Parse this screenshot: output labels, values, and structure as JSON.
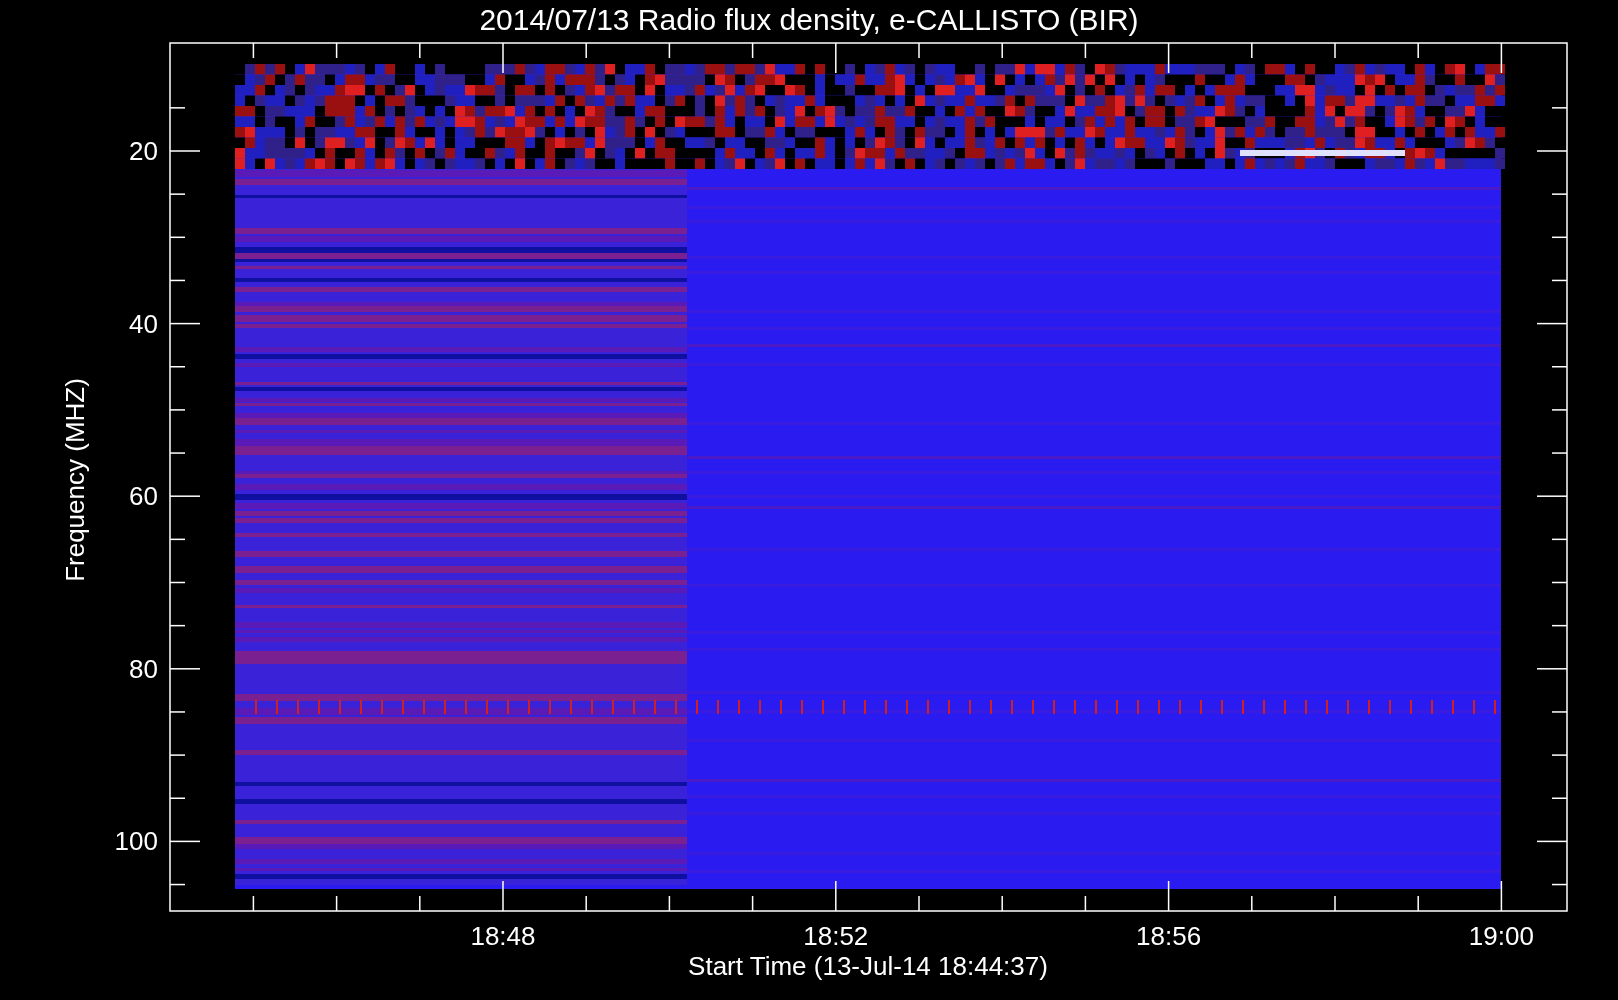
{
  "title": "2014/07/13  Radio flux density, e-CALLISTO (BIR)",
  "y_axis": {
    "label": "Frequency (MHZ)",
    "ticks": [
      "20",
      "40",
      "60",
      "80",
      "100"
    ]
  },
  "x_axis": {
    "label": "Start Time (13-Jul-14 18:44:37)",
    "ticks": [
      "18:48",
      "18:52",
      "18:56",
      "19:00"
    ]
  }
}
